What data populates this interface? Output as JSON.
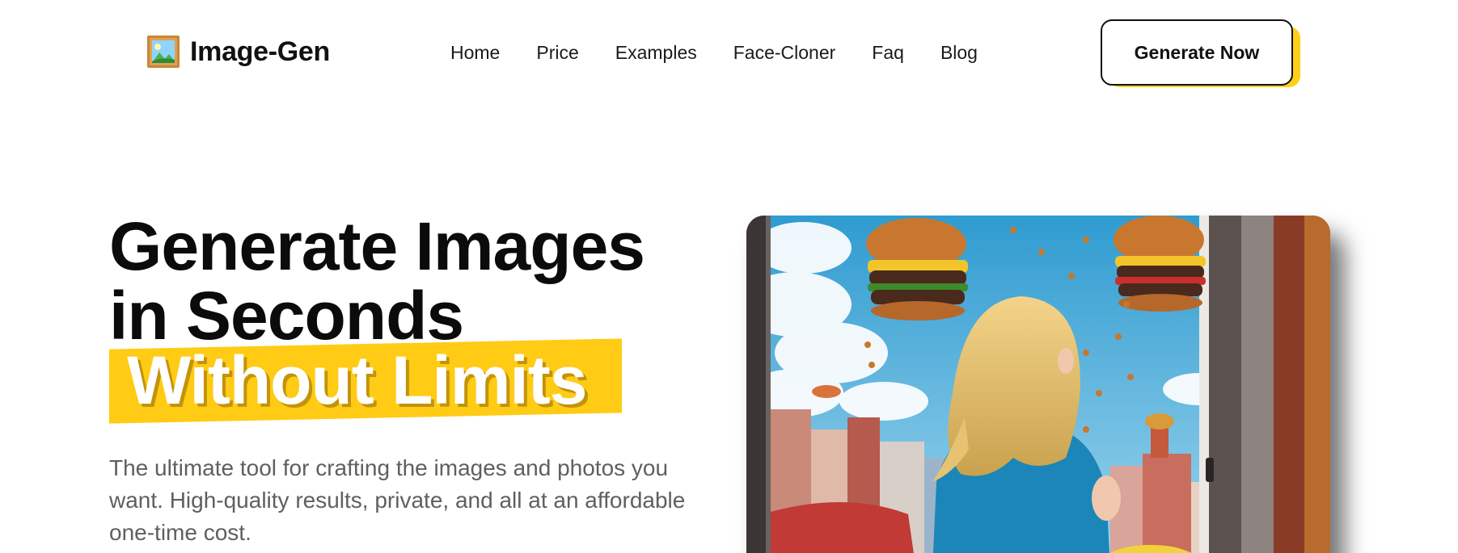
{
  "header": {
    "logo_text": "Image-Gen",
    "logo_icon": "framed-picture-icon",
    "nav": [
      "Home",
      "Price",
      "Examples",
      "Face-Cloner",
      "Faq",
      "Blog"
    ],
    "cta_label": "Generate Now"
  },
  "hero": {
    "headline_line1": "Generate Images",
    "headline_line2": "in Seconds",
    "highlight": "Without Limits",
    "subtext": "The ultimate tool for crafting the images and photos you want. High-quality results, private, and all at an affordable one-time cost.",
    "image_subject": "girl-with-floating-burgers-illustration"
  },
  "colors": {
    "accent": "#ffcb14",
    "text": "#0b0b0b",
    "muted": "#5f5f5f"
  }
}
